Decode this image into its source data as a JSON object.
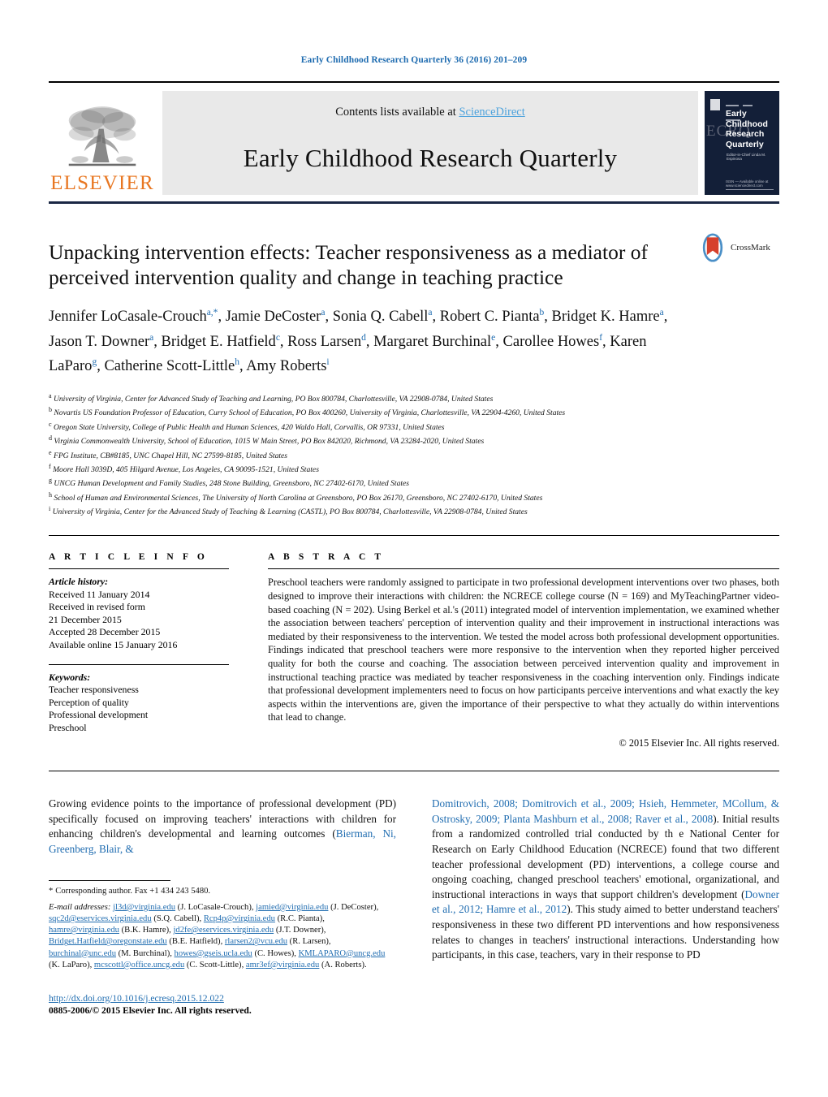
{
  "running_head": "Early Childhood Research Quarterly 36 (2016) 201–209",
  "masthead": {
    "contents_prefix": "Contents lists available at ",
    "sciencedirect": "ScienceDirect",
    "journal_title": "Early Childhood Research Quarterly",
    "publisher_wordmark": "ELSEVIER",
    "cover": {
      "title_lines": "Early Childhood Research Quarterly",
      "spine_text": "ECRQ",
      "sub_text": "Editor-in-Chief\nLinda M. Espinosa",
      "bottom_text": "ISSN  —  Available online at www.sciencedirect.com"
    }
  },
  "article": {
    "title": "Unpacking intervention effects: Teacher responsiveness as a mediator of perceived intervention quality and change in teaching practice",
    "crossmark_label": "CrossMark",
    "authors": [
      {
        "name": "Jennifer LoCasale-Crouch",
        "sup": "a,*"
      },
      {
        "name": "Jamie DeCoster",
        "sup": "a"
      },
      {
        "name": "Sonia Q. Cabell",
        "sup": "a"
      },
      {
        "name": "Robert C. Pianta",
        "sup": "b"
      },
      {
        "name": "Bridget K. Hamre",
        "sup": "a"
      },
      {
        "name": "Jason T. Downer",
        "sup": "a"
      },
      {
        "name": "Bridget E. Hatfield",
        "sup": "c"
      },
      {
        "name": "Ross Larsen",
        "sup": "d"
      },
      {
        "name": "Margaret Burchinal",
        "sup": "e"
      },
      {
        "name": "Carollee Howes",
        "sup": "f"
      },
      {
        "name": "Karen LaParo",
        "sup": "g"
      },
      {
        "name": "Catherine Scott-Little",
        "sup": "h"
      },
      {
        "name": "Amy Roberts",
        "sup": "i"
      }
    ],
    "affiliations": [
      {
        "mark": "a",
        "text": "University of Virginia, Center for Advanced Study of Teaching and Learning, PO Box 800784, Charlottesville, VA 22908-0784, United States"
      },
      {
        "mark": "b",
        "text": "Novartis US Foundation Professor of Education, Curry School of Education, PO Box 400260, University of Virginia, Charlottesville, VA 22904-4260, United States"
      },
      {
        "mark": "c",
        "text": "Oregon State University, College of Public Health and Human Sciences, 420 Waldo Hall, Corvallis, OR 97331, United States"
      },
      {
        "mark": "d",
        "text": "Virginia Commonwealth University, School of Education, 1015 W Main Street, PO Box 842020, Richmond, VA 23284-2020, United States"
      },
      {
        "mark": "e",
        "text": "FPG Institute, CB#8185, UNC Chapel Hill, NC 27599-8185, United States"
      },
      {
        "mark": "f",
        "text": "Moore Hall 3039D, 405 Hilgard Avenue, Los Angeles, CA 90095-1521, United States"
      },
      {
        "mark": "g",
        "text": "UNCG Human Development and Family Studies, 248 Stone Building, Greensboro, NC 27402-6170, United States"
      },
      {
        "mark": "h",
        "text": "School of Human and Environmental Sciences, The University of North Carolina at Greensboro, PO Box 26170, Greensboro, NC 27402-6170, United States"
      },
      {
        "mark": "i",
        "text": "University of Virginia, Center for the Advanced Study of Teaching & Learning (CASTL), PO Box 800784, Charlottesville, VA 22908-0784, United States"
      }
    ]
  },
  "article_info": {
    "heading": "A R T I C L E  I N F O",
    "history_label": "Article history:",
    "history": [
      "Received 11 January 2014",
      "Received in revised form",
      "21 December 2015",
      "Accepted 28 December 2015",
      "Available online 15 January 2016"
    ],
    "keywords_label": "Keywords:",
    "keywords": [
      "Teacher responsiveness",
      "Perception of quality",
      "Professional development",
      "Preschool"
    ]
  },
  "abstract": {
    "heading": "A B S T R A C T",
    "text": "Preschool teachers were randomly assigned to participate in two professional development interventions over two phases, both designed to improve their interactions with children: the NCRECE college course (N = 169) and MyTeachingPartner video-based coaching (N = 202). Using Berkel et al.'s (2011) integrated model of intervention implementation, we examined whether the association between teachers' perception of intervention quality and their improvement in instructional interactions was mediated by their responsiveness to the intervention. We tested the model across both professional development opportunities. Findings indicated that preschool teachers were more responsive to the intervention when they reported higher perceived quality for both the course and coaching. The association between perceived intervention quality and improvement in instructional teaching practice was mediated by teacher responsiveness in the coaching intervention only. Findings indicate that professional development implementers need to focus on how participants perceive interventions and what exactly the key aspects within the interventions are, given the importance of their perspective to what they actually do within interventions that lead to change.",
    "copyright": "© 2015 Elsevier Inc. All rights reserved."
  },
  "body": {
    "left_paragraph_part1": "Growing evidence points to the importance of professional development (PD) specifically focused on improving teachers' interactions with children for enhancing children's developmental and learning outcomes (",
    "left_paragraph_ref": "Bierman, Ni, Greenberg, Blair, &",
    "right_ref_continued": "Domitrovich, 2008; Domitrovich et al., 2009; Hsieh, Hemmeter, MCollum, & Ostrosky, 2009; Planta Mashburn et al., 2008; Raver et al., 2008",
    "right_paragraph_part2": "). Initial results from a randomized controlled trial conducted by th e National Center for Research on Early Childhood Education (NCRECE) found that two different teacher professional development (PD) interventions, a college course and ongoing coaching, changed preschool teachers' emotional, organizational, and instructional interactions in ways that support children's development (",
    "right_ref_2": "Downer et al., 2012; Hamre et al., 2012",
    "right_paragraph_part3": "). This study aimed to better understand teachers' responsiveness in these two different PD interventions and how responsiveness relates to changes in teachers' instructional interactions. Understanding how participants, in this case, teachers, vary in their response to PD"
  },
  "footnotes": {
    "corresponding_star": "*",
    "corresponding": "Corresponding author. Fax +1 434 243 5480.",
    "email_label": "E-mail addresses:",
    "emails": [
      {
        "address": "jl3d@virginia.edu",
        "person": "(J. LoCasale-Crouch),"
      },
      {
        "address": "jamied@virginia.edu",
        "person": "(J. DeCoster),"
      },
      {
        "address": "sqc2d@eservices.virginia.edu",
        "person": "(S.Q. Cabell),"
      },
      {
        "address": "Rcp4p@virginia.edu",
        "person": "(R.C. Pianta),"
      },
      {
        "address": "hamre@virginia.edu",
        "person": "(B.K. Hamre),"
      },
      {
        "address": "jd2fe@eservices.virginia.edu",
        "person": "(J.T. Downer),"
      },
      {
        "address": "Bridget.Hatfield@oregonstate.edu",
        "person": "(B.E. Hatfield),"
      },
      {
        "address": "rlarsen2@vcu.edu",
        "person": "(R. Larsen),"
      },
      {
        "address": "burchinal@unc.edu",
        "person": "(M. Burchinal),"
      },
      {
        "address": "howes@gseis.ucla.edu",
        "person": "(C. Howes),"
      },
      {
        "address": "KMLAPARO@uncg.edu",
        "person": "(K. LaParo),"
      },
      {
        "address": "mcscottl@office.uncg.edu",
        "person": "(C. Scott-Little),"
      },
      {
        "address": "amr3ef@virginia.edu",
        "person": "(A. Roberts)."
      }
    ]
  },
  "footer": {
    "doi": "http://dx.doi.org/10.1016/j.ecresq.2015.12.022",
    "issn_line": "0885-2006/© 2015 Elsevier Inc. All rights reserved."
  }
}
